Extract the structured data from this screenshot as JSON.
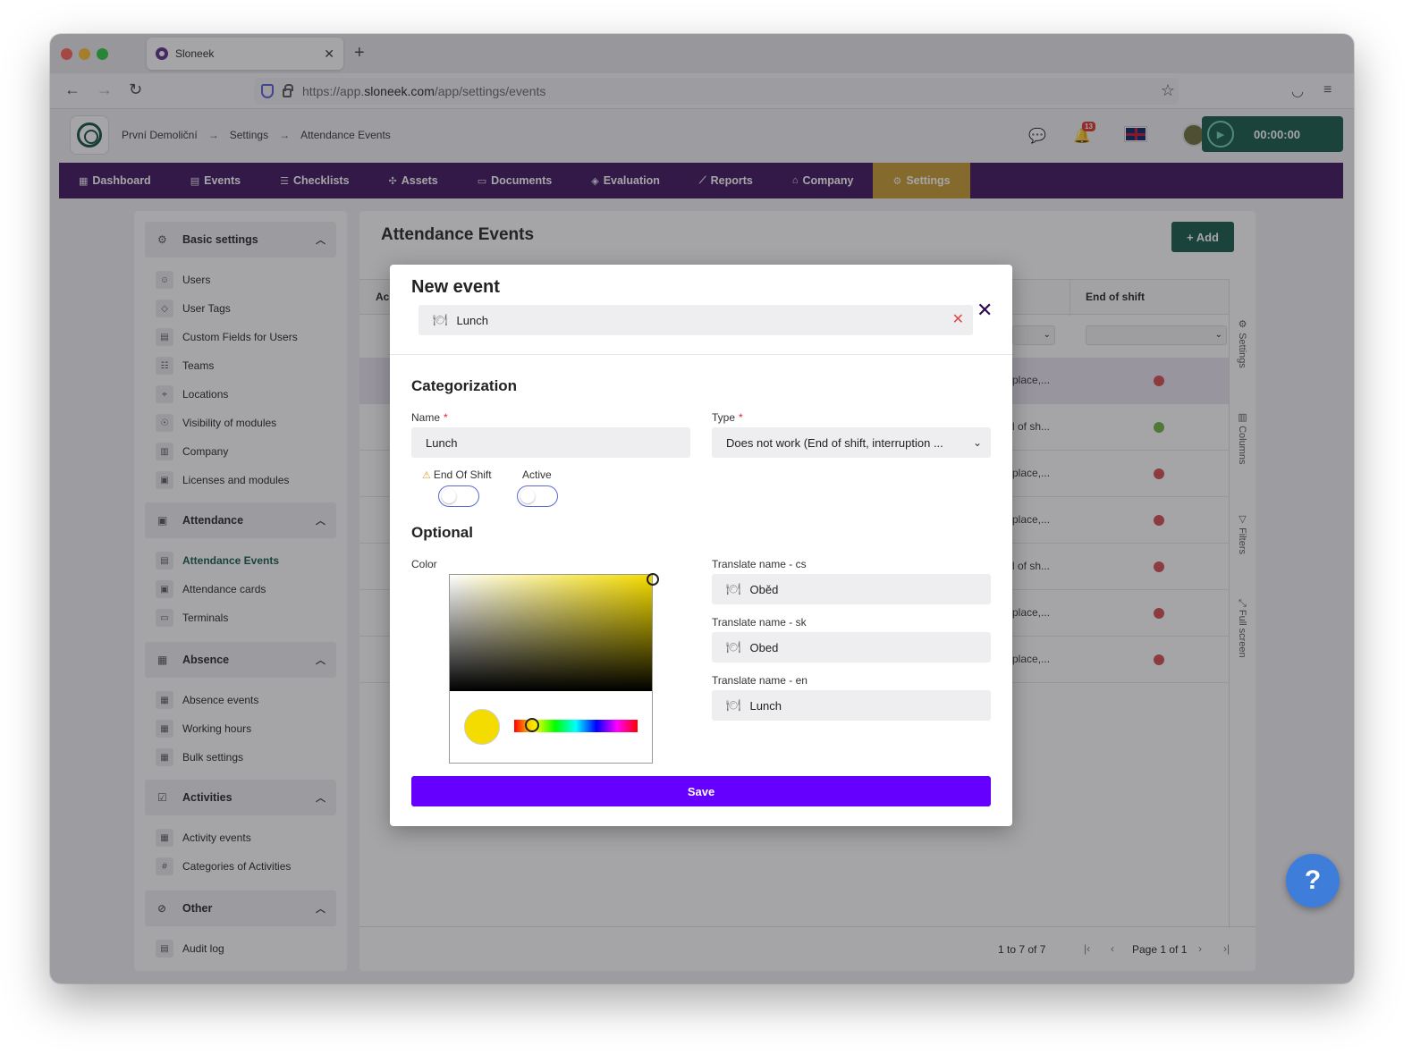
{
  "browser": {
    "tab_title": "Sloneek",
    "tab_close": "✕",
    "new_tab": "+",
    "url_prefix": "https://app.",
    "url_host": "sloneek.com",
    "url_path": "/app/settings/events"
  },
  "header": {
    "breadcrumbs": [
      "První Demoliční",
      "Settings",
      "Attendance Events"
    ],
    "breadcrumb_arrow": "→",
    "notification_count": "13",
    "timer": "00:00:00"
  },
  "menu": [
    {
      "label": "Dashboard",
      "icon": "▦"
    },
    {
      "label": "Events",
      "icon": "▤"
    },
    {
      "label": "Checklists",
      "icon": "☰"
    },
    {
      "label": "Assets",
      "icon": "✣"
    },
    {
      "label": "Documents",
      "icon": "▭"
    },
    {
      "label": "Evaluation",
      "icon": "◈"
    },
    {
      "label": "Reports",
      "icon": "⟋"
    },
    {
      "label": "Company",
      "icon": "⌂"
    },
    {
      "label": "Settings",
      "icon": "⚙"
    }
  ],
  "sidebar": {
    "sections": [
      {
        "label": "Basic settings",
        "icon": "⚙"
      },
      {
        "label": "Attendance",
        "icon": "▣"
      },
      {
        "label": "Absence",
        "icon": "▦"
      },
      {
        "label": "Activities",
        "icon": "☑"
      },
      {
        "label": "Other",
        "icon": "⊘"
      }
    ],
    "items": [
      {
        "label": "Users",
        "icon": "☺"
      },
      {
        "label": "User Tags",
        "icon": "◇"
      },
      {
        "label": "Custom Fields for Users",
        "icon": "▤"
      },
      {
        "label": "Teams",
        "icon": "☷"
      },
      {
        "label": "Locations",
        "icon": "⌖"
      },
      {
        "label": "Visibility of modules",
        "icon": "☉"
      },
      {
        "label": "Company",
        "icon": "▥"
      },
      {
        "label": "Licenses and modules",
        "icon": "▣"
      },
      {
        "label": "Attendance Events",
        "icon": "▤"
      },
      {
        "label": "Attendance cards",
        "icon": "▣"
      },
      {
        "label": "Terminals",
        "icon": "▭"
      },
      {
        "label": "Absence events",
        "icon": "▦"
      },
      {
        "label": "Working hours",
        "icon": "▦"
      },
      {
        "label": "Bulk settings",
        "icon": "▦"
      },
      {
        "label": "Activity events",
        "icon": "▦"
      },
      {
        "label": "Categories of Activities",
        "icon": "#"
      },
      {
        "label": "Audit log",
        "icon": "▤"
      }
    ]
  },
  "main": {
    "title": "Attendance Events",
    "add_label": "+ Add",
    "col_ac": "Ac",
    "col_end_of_shift": "End of shift",
    "rows": [
      {
        "text": "place,...",
        "dot_color": "#d34a4a"
      },
      {
        "text": "l of sh...",
        "dot_color": "#6db33f"
      },
      {
        "text": "place,...",
        "dot_color": "#d34a4a"
      },
      {
        "text": "place,...",
        "dot_color": "#d34a4a"
      },
      {
        "text": "l of sh...",
        "dot_color": "#d34a4a"
      },
      {
        "text": "place,...",
        "dot_color": "#d34a4a"
      },
      {
        "text": "place,...",
        "dot_color": "#d34a4a"
      }
    ],
    "side_tools": [
      "Settings",
      "Columns",
      "Filters",
      "Full screen"
    ],
    "pager": {
      "count_text": "1 to 7 of 7",
      "page_text": "Page 1 of 1"
    }
  },
  "modal": {
    "title": "New event",
    "search_value": "Lunch",
    "section_categorization": "Categorization",
    "name_label": "Name",
    "name_value": "Lunch",
    "type_label": "Type",
    "type_value": "Does not work (End of shift, interruption ...",
    "end_of_shift_label": "End Of Shift",
    "active_label": "Active",
    "section_optional": "Optional",
    "color_label": "Color",
    "color_value": "#f5dc00",
    "translations": [
      {
        "label": "Translate name - cs",
        "value": "Oběd"
      },
      {
        "label": "Translate name - sk",
        "value": "Obed"
      },
      {
        "label": "Translate name - en",
        "value": "Lunch"
      }
    ],
    "save_label": "Save",
    "required_mark": "*"
  },
  "help": {
    "label": "?"
  },
  "colors": {
    "brand_dark": "#3a0f5c",
    "brand_green": "#0f5746",
    "settings_active": "#c8992e",
    "save_purple": "#6500ff",
    "help_blue": "#3f7ddb"
  }
}
